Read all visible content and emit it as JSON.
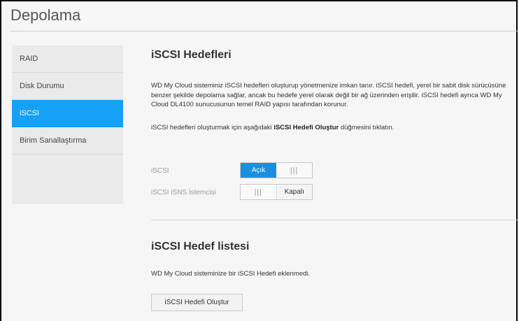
{
  "page": {
    "title": "Depolama"
  },
  "sidebar": {
    "items": [
      {
        "label": "RAID"
      },
      {
        "label": "Disk Durumu"
      },
      {
        "label": "iSCSI"
      },
      {
        "label": "Birim Sanallaştırma"
      }
    ],
    "active_index": 2
  },
  "targets": {
    "heading": "iSCSI Hedefleri",
    "description": "WD My Cloud  sisteminiz iSCSI hedefleri oluşturup yönetmenize imkan tanır. iSCSI hedefi, yerel bir sabit disk sürücüsüne benzer şekilde depolama sağlar, ancak bu hedefe yerel olarak değil bir ağ üzerinden erişilir. iSCSI hedefi ayrıca WD My Cloud DL4100 sunucusunun temel RAID yapısı tarafından korunur.",
    "instruction_prefix": "iSCSI hedefleri oluşturmak için aşağıdaki ",
    "instruction_bold": "iSCSI Hedefi Oluştur",
    "instruction_suffix": " düğmesini tıklatın."
  },
  "settings": {
    "iscsi": {
      "label": "iSCSI",
      "state_label": "Açık",
      "grip": "|||"
    },
    "isns": {
      "label": "iSCSI iSNS İstemcisi",
      "state_label": "Kapalı",
      "grip": "|||"
    }
  },
  "target_list": {
    "heading": "iSCSI Hedef listesi",
    "empty_message": "WD My Cloud  sisteminize bir iSCSI Hedefi eklenmedi.",
    "create_button": "iSCSI Hedefi Oluştur"
  },
  "colors": {
    "accent": "#15a1f5",
    "toggle_on": "#1a8fe0"
  }
}
